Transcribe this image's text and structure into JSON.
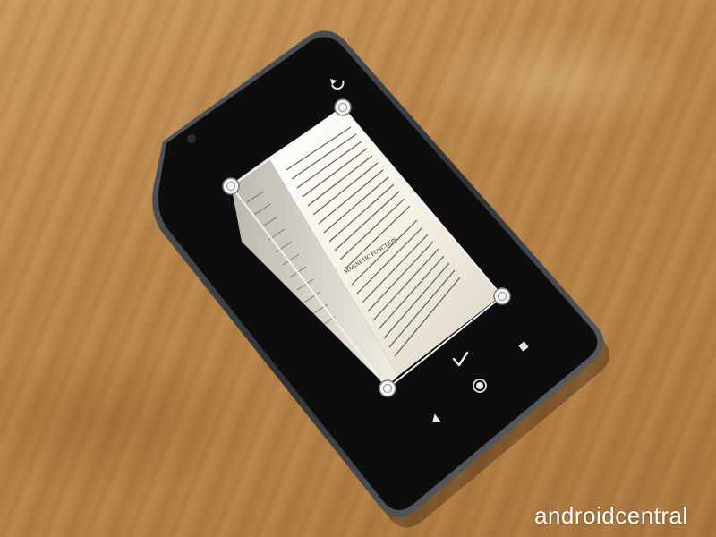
{
  "photo": {
    "subject": "",
    "watermark": "androidcentral"
  },
  "document_scanner": {
    "book_heading": "MAGNETIC FUNCTION",
    "controls": {
      "rotate": "rotate-icon",
      "confirm": "checkmark-icon",
      "shutter": "shutter-icon"
    }
  },
  "android_nav": {
    "back": "back-triangle-icon",
    "home": "home-circle-icon",
    "recents": "recents-square-icon"
  },
  "colors": {
    "phone_body": "#0d0d0d",
    "phone_frame": "#3a3d42",
    "page_paper": "#f4efe0",
    "handle_fill": "#f2f2f2",
    "wood": "#b98a50"
  }
}
